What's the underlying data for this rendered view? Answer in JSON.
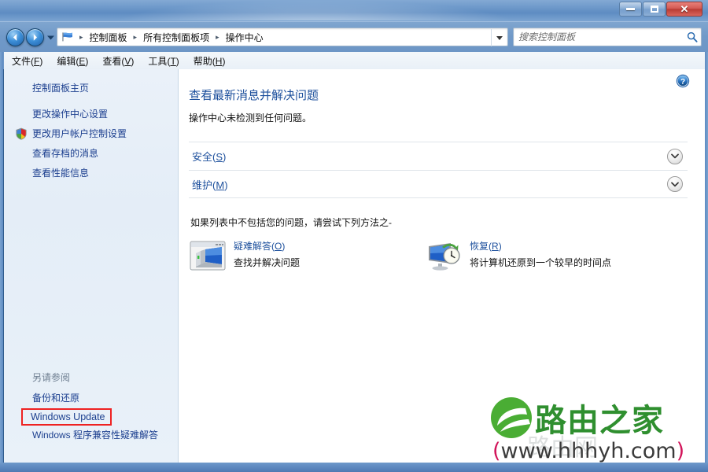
{
  "window": {
    "title": "",
    "buttons": {
      "minimize": "minimize",
      "maximize": "maximize",
      "close": "close"
    }
  },
  "navigation": {
    "back": "back-arrow",
    "forward": "forward-arrow",
    "history_dropdown": "recent-pages",
    "refresh": "refresh",
    "breadcrumb": [
      "控制面板",
      "所有控制面板项",
      "操作中心"
    ],
    "breadcrumb_separator": "▸",
    "address_dropdown": "▾"
  },
  "search": {
    "placeholder": "搜索控制面板",
    "value": "",
    "icon": "search-icon"
  },
  "menubar": [
    {
      "label": "文件",
      "accel": "F"
    },
    {
      "label": "编辑",
      "accel": "E"
    },
    {
      "label": "查看",
      "accel": "V"
    },
    {
      "label": "工具",
      "accel": "T"
    },
    {
      "label": "帮助",
      "accel": "H"
    }
  ],
  "sidebar": {
    "home_label": "控制面板主页",
    "items": [
      {
        "label": "更改操作中心设置",
        "shield": false
      },
      {
        "label": "更改用户帐户控制设置",
        "shield": true
      },
      {
        "label": "查看存档的消息",
        "shield": false
      },
      {
        "label": "查看性能信息",
        "shield": false
      }
    ],
    "see_also_title": "另请参阅",
    "see_also": [
      {
        "label": "备份和还原",
        "highlighted": false
      },
      {
        "label": "Windows Update",
        "highlighted": true
      },
      {
        "label": "Windows 程序兼容性疑难解答",
        "highlighted": false
      }
    ],
    "highlight_color": "#ee2222"
  },
  "main": {
    "help_icon": "help-icon",
    "heading": "查看最新消息并解决问题",
    "subtext": "操作中心未检测到任何问题。",
    "sections": [
      {
        "label": "安全",
        "accel": "S",
        "expanded": false,
        "chevron": "chevron-down-icon"
      },
      {
        "label": "维护",
        "accel": "M",
        "expanded": false,
        "chevron": "chevron-down-icon"
      }
    ],
    "try_line": "如果列表中不包括您的问题，请尝试下列方法之-",
    "tiles": [
      {
        "icon": "troubleshoot-monitor-icon",
        "title": "疑难解答",
        "accel": "O",
        "desc": "查找并解决问题"
      },
      {
        "icon": "recovery-clock-icon",
        "title": "恢复",
        "accel": "R",
        "desc": "将计算机还原到一个较早的时间点"
      }
    ]
  },
  "watermark": {
    "brand": "路由之家",
    "url_open": "(",
    "url": "www.hhhyh.com",
    "url_close": ")",
    "ghost": "路由网",
    "brand_color": "#2f8f2f"
  }
}
